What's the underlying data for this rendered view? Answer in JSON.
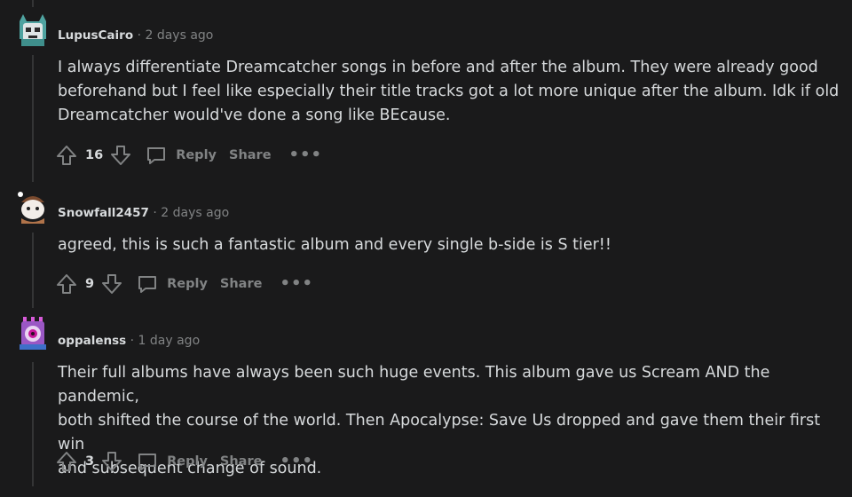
{
  "comments": [
    {
      "author": "LupusCairo",
      "time": "2 days ago",
      "text": "I always differentiate Dreamcatcher songs in before and after the album. They were already good\nbeforehand but I feel like especially their title tracks got a lot more unique after the album. Idk if old\nDreamcatcher would've done a song like BEcause.",
      "score": "16",
      "reply_label": "Reply",
      "share_label": "Share",
      "more_label": "•••",
      "avatar_color": "#5fb3b3"
    },
    {
      "author": "Snowfall2457",
      "time": "2 days ago",
      "text": "agreed, this is such a fantastic album and every single b-side is S tier!!",
      "score": "9",
      "reply_label": "Reply",
      "share_label": "Share",
      "more_label": "•••",
      "avatar_color": "#b08a6e"
    },
    {
      "author": "oppalenss",
      "time": "1 day ago",
      "text": "Their full albums have always been such huge events. This album gave us Scream AND the pandemic,\nboth shifted the course of the world. Then Apocalypse: Save Us dropped and gave them their first win\nand subsequent change of sound.",
      "score": "3",
      "reply_label": "Reply",
      "share_label": "Share",
      "more_label": "•••",
      "avatar_color": "#c45ad8"
    }
  ],
  "separator": "·"
}
